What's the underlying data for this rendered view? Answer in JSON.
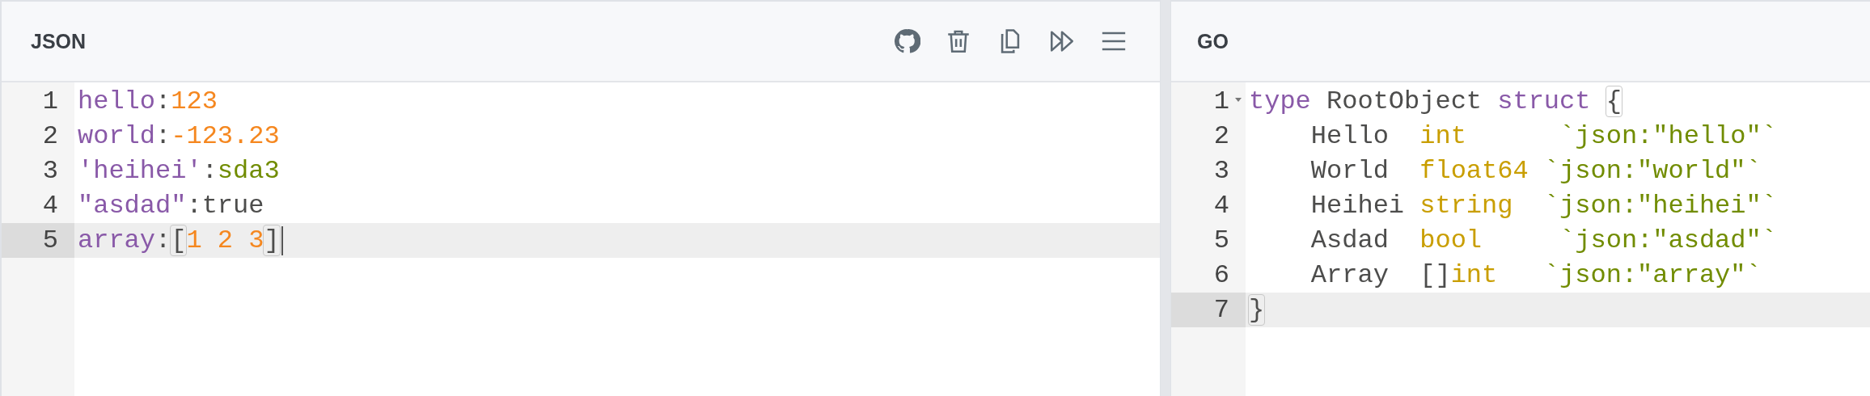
{
  "panels": [
    {
      "title": "JSON",
      "toolbar": [
        {
          "kind": "github"
        },
        {
          "kind": "delete"
        },
        {
          "kind": "copy"
        },
        {
          "kind": "run"
        },
        {
          "kind": "menu"
        }
      ],
      "lines": [
        {
          "number": "1",
          "active": false,
          "tokens": [
            {
              "text": "hello",
              "kind": "key"
            },
            {
              "text": ":",
              "kind": "plain"
            },
            {
              "text": "123",
              "kind": "number"
            }
          ]
        },
        {
          "number": "2",
          "active": false,
          "tokens": [
            {
              "text": "world",
              "kind": "key"
            },
            {
              "text": ":",
              "kind": "plain"
            },
            {
              "text": "-123.23",
              "kind": "number"
            }
          ]
        },
        {
          "number": "3",
          "active": false,
          "tokens": [
            {
              "text": "'heihei'",
              "kind": "key"
            },
            {
              "text": ":",
              "kind": "plain"
            },
            {
              "text": "sda3",
              "kind": "string"
            }
          ]
        },
        {
          "number": "4",
          "active": false,
          "tokens": [
            {
              "text": "\"asdad\"",
              "kind": "key"
            },
            {
              "text": ":",
              "kind": "plain"
            },
            {
              "text": "true",
              "kind": "plain"
            }
          ]
        },
        {
          "number": "5",
          "active": true,
          "cursor": true,
          "tokens": [
            {
              "text": "array",
              "kind": "key"
            },
            {
              "text": ":",
              "kind": "plain"
            },
            {
              "text": "[",
              "kind": "bracket-match"
            },
            {
              "text": "1 2 3",
              "kind": "number"
            },
            {
              "text": "]",
              "kind": "bracket-match"
            }
          ]
        }
      ]
    },
    {
      "title": "GO",
      "lines": [
        {
          "number": "1",
          "active": false,
          "foldable": true,
          "tokens": [
            {
              "text": "type",
              "kind": "keyword"
            },
            {
              "text": " RootObject ",
              "kind": "plain"
            },
            {
              "text": "struct ",
              "kind": "keyword"
            },
            {
              "text": "{",
              "kind": "bracket-match"
            }
          ]
        },
        {
          "number": "2",
          "active": false,
          "tokens": [
            {
              "text": "    Hello  ",
              "kind": "plain"
            },
            {
              "text": "int      ",
              "kind": "type"
            },
            {
              "text": "`json:\"hello\"`",
              "kind": "string"
            }
          ]
        },
        {
          "number": "3",
          "active": false,
          "tokens": [
            {
              "text": "    World  ",
              "kind": "plain"
            },
            {
              "text": "float64 ",
              "kind": "type"
            },
            {
              "text": "`json:\"world\"`",
              "kind": "string"
            }
          ]
        },
        {
          "number": "4",
          "active": false,
          "tokens": [
            {
              "text": "    Heihei ",
              "kind": "plain"
            },
            {
              "text": "string  ",
              "kind": "type"
            },
            {
              "text": "`json:\"heihei\"`",
              "kind": "string"
            }
          ]
        },
        {
          "number": "5",
          "active": false,
          "tokens": [
            {
              "text": "    Asdad  ",
              "kind": "plain"
            },
            {
              "text": "bool     ",
              "kind": "type"
            },
            {
              "text": "`json:\"asdad\"`",
              "kind": "string"
            }
          ]
        },
        {
          "number": "6",
          "active": false,
          "tokens": [
            {
              "text": "    Array  ",
              "kind": "plain"
            },
            {
              "text": "[]",
              "kind": "plain"
            },
            {
              "text": "int   ",
              "kind": "type"
            },
            {
              "text": "`json:\"array\"`",
              "kind": "string"
            }
          ]
        },
        {
          "number": "7",
          "active": true,
          "tokens": [
            {
              "text": "}",
              "kind": "bracket-match"
            }
          ]
        }
      ]
    }
  ]
}
